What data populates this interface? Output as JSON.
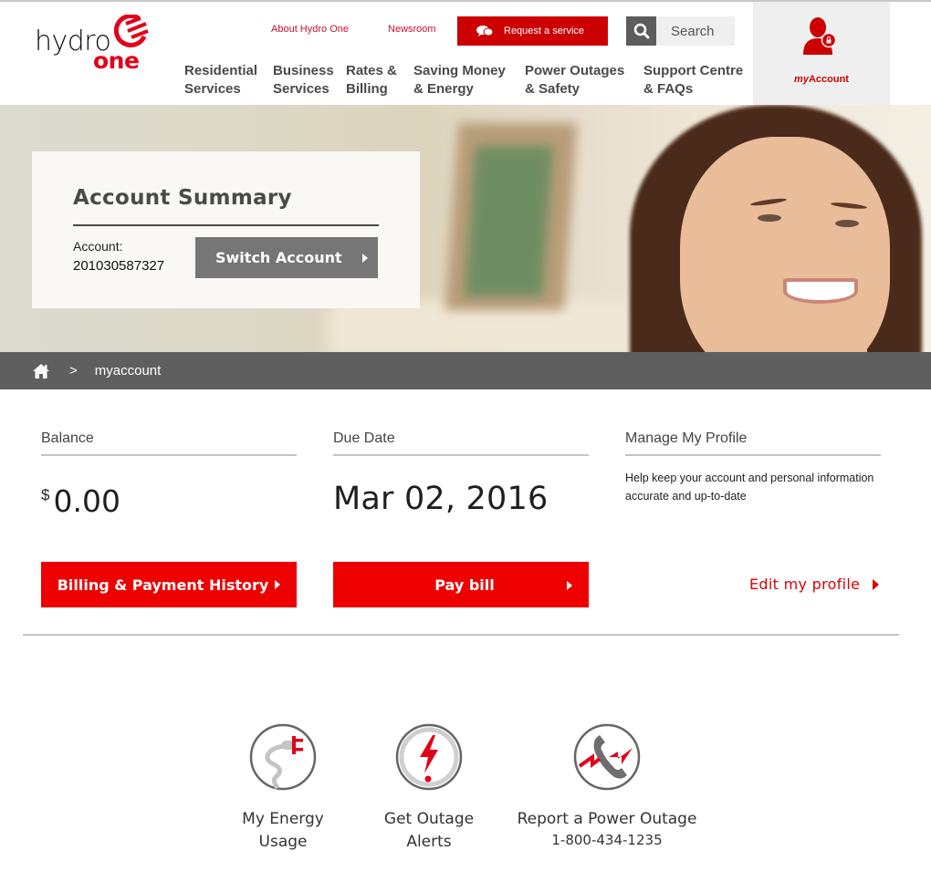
{
  "brand": {
    "logo_word1": "hydro",
    "logo_word2": "one",
    "accent_color": "#e1001a"
  },
  "utility_nav": {
    "about": "About Hydro One",
    "newsroom": "Newsroom",
    "request_service": "Request a service",
    "search_placeholder": "Search"
  },
  "main_nav": [
    {
      "label": "Residential\nServices"
    },
    {
      "label": "Business\nServices"
    },
    {
      "label": "Rates &\nBilling"
    },
    {
      "label": "Saving Money\n& Energy"
    },
    {
      "label": "Power Outages\n& Safety"
    },
    {
      "label": "Support Centre\n& FAQs"
    }
  ],
  "myaccount": {
    "prefix": "my",
    "suffix": "Account"
  },
  "hero": {
    "title": "Account Summary",
    "account_label": "Account:",
    "account_number": "201030587327",
    "switch_label": "Switch Account"
  },
  "breadcrumb": {
    "separator": ">",
    "current": "myaccount"
  },
  "summary": {
    "balance": {
      "heading": "Balance",
      "currency": "$",
      "amount": "0.00",
      "button": "Billing & Payment History"
    },
    "due_date": {
      "heading": "Due Date",
      "value": "Mar 02, 2016",
      "button": "Pay bill"
    },
    "profile": {
      "heading": "Manage My Profile",
      "description": "Help keep your account and personal information accurate and up-to-date",
      "link": "Edit my profile"
    }
  },
  "quick_links": [
    {
      "label": "My Energy\nUsage",
      "icon": "plug-icon"
    },
    {
      "label": "Get Outage\nAlerts",
      "icon": "lightning-alert-icon"
    },
    {
      "label": "Report a Power Outage",
      "phone": "1-800-434-1235",
      "icon": "phone-outage-icon"
    }
  ]
}
